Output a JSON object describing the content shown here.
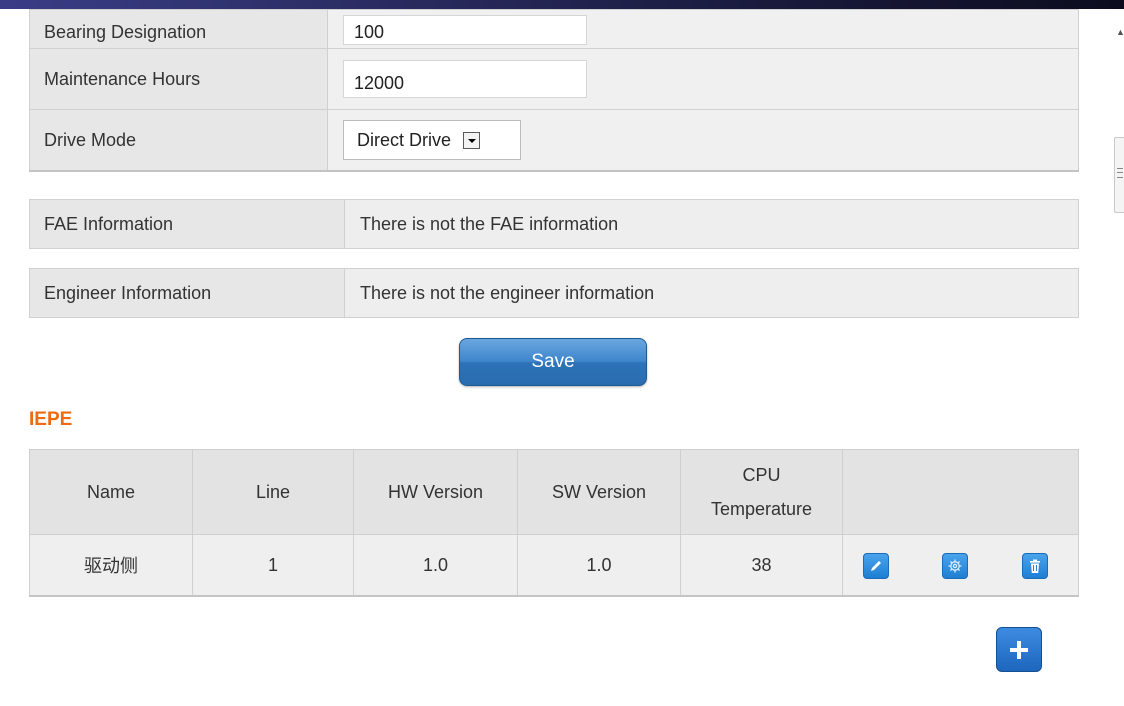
{
  "form": {
    "bearing_label": "Bearing Designation",
    "bearing_value": "100",
    "maintenance_label": "Maintenance Hours",
    "maintenance_value": "12000",
    "drive_label": "Drive Mode",
    "drive_value": "Direct Drive"
  },
  "fae": {
    "label": "FAE Information",
    "value": "There is not the FAE information"
  },
  "engineer": {
    "label": "Engineer Information",
    "value": "There is not the engineer information"
  },
  "save_label": "Save",
  "section_title": "IEPE",
  "device_table": {
    "headers": {
      "name": "Name",
      "line": "Line",
      "hw": "HW Version",
      "sw": "SW Version",
      "cpu_line1": "CPU",
      "cpu_line2": "Temperature"
    },
    "rows": [
      {
        "name": "驱动侧",
        "line": "1",
        "hw": "1.0",
        "sw": "1.0",
        "cpu": "38"
      }
    ]
  },
  "icons": {
    "edit": "pencil-icon",
    "settings": "gear-icon",
    "delete": "trash-icon",
    "add": "plus-icon"
  },
  "colors": {
    "accent": "#ee6a10",
    "button_blue": "#2d72b8"
  }
}
